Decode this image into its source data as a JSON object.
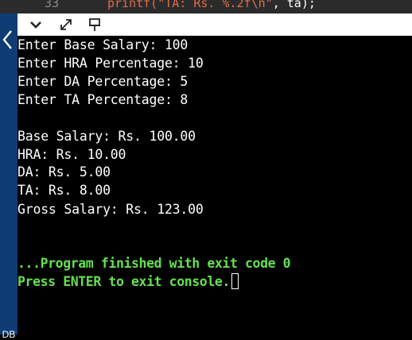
{
  "editor": {
    "line_number": "33",
    "code_fn": "printf(",
    "code_str": "\"TA: Rs. %.2f\\n\"",
    "code_rest": ", ta);"
  },
  "toolbar": {
    "icons": [
      "chevron-down-icon",
      "expand-icon",
      "pin-icon"
    ]
  },
  "rail": {
    "label": "DB"
  },
  "console": {
    "lines": [
      "Enter Base Salary: 100",
      "Enter HRA Percentage: 10",
      "Enter DA Percentage: 5",
      "Enter TA Percentage: 8",
      "",
      "Base Salary: Rs. 100.00",
      "HRA: Rs. 10.00",
      "DA: Rs. 5.00",
      "TA: Rs. 8.00",
      "Gross Salary: Rs. 123.00"
    ],
    "finished": "...Program finished with exit code 0",
    "prompt": "Press ENTER to exit console."
  },
  "colors": {
    "console_bg": "#000000",
    "output_text": "#ffffff",
    "finish_text": "#64e04f",
    "rail_bg": "#0f3c74",
    "code_string": "#e06c4b"
  }
}
